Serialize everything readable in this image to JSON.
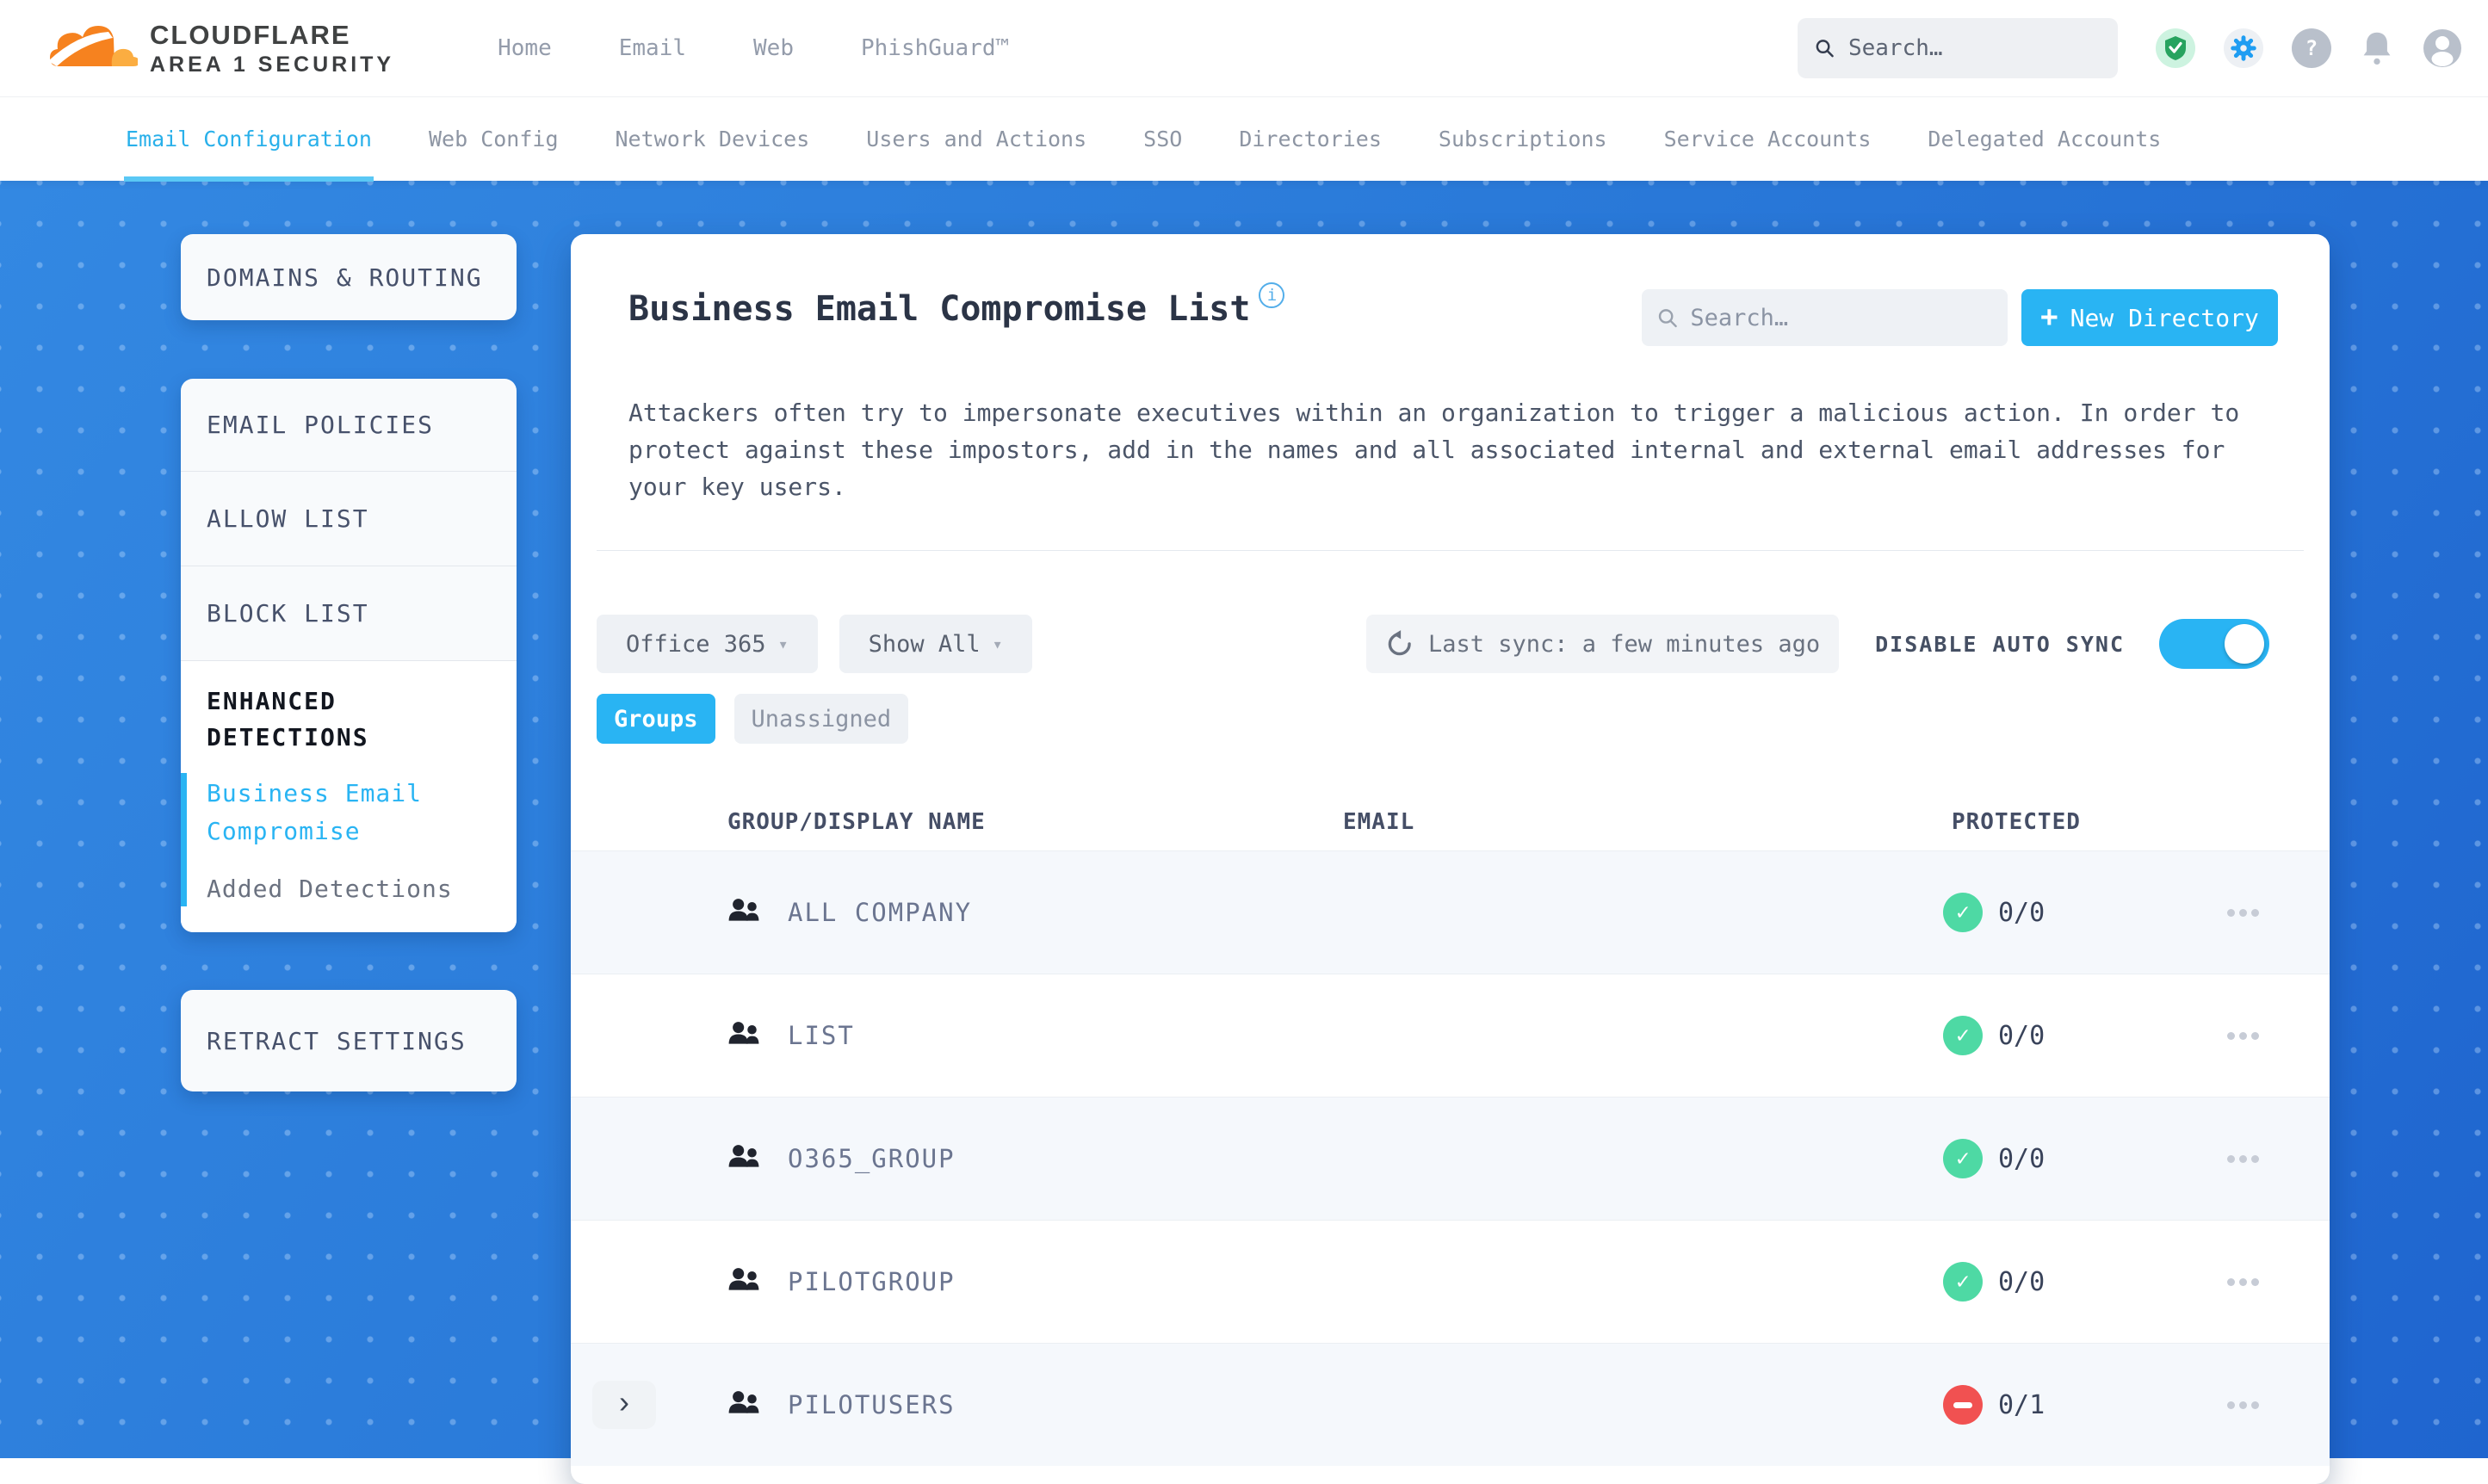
{
  "colors": {
    "accent": "#29b4f3",
    "success": "#4ed9a4",
    "danger": "#f15151",
    "canvas_blue": "#2a7ad9"
  },
  "brand": {
    "name": "CLOUDFLARE",
    "sub": "AREA 1 SECURITY"
  },
  "top_nav": {
    "items": [
      "Home",
      "Email",
      "Web",
      "PhishGuard™"
    ],
    "search_placeholder": "Search…"
  },
  "tabs": {
    "items": [
      {
        "label": "Email Configuration",
        "active": true
      },
      {
        "label": "Web Config",
        "active": false
      },
      {
        "label": "Network Devices",
        "active": false
      },
      {
        "label": "Users and Actions",
        "active": false
      },
      {
        "label": "SSO",
        "active": false
      },
      {
        "label": "Directories",
        "active": false
      },
      {
        "label": "Subscriptions",
        "active": false
      },
      {
        "label": "Service Accounts",
        "active": false
      },
      {
        "label": "Delegated Accounts",
        "active": false
      }
    ]
  },
  "sidebar": {
    "domains_routing": "DOMAINS & ROUTING",
    "email_policies": "EMAIL POLICIES",
    "allow_list": "ALLOW LIST",
    "block_list": "BLOCK LIST",
    "enhanced_detections": "ENHANCED DETECTIONS",
    "business_email_compromise": "Business Email Compromise",
    "added_detections": "Added Detections",
    "retract_settings": "RETRACT SETTINGS"
  },
  "main": {
    "title": "Business Email Compromise List",
    "search_placeholder": "Search…",
    "new_directory_label": "New Directory",
    "plus": "+",
    "description": "Attackers often try to impersonate executives within an organization to trigger a malicious action. In order to protect against these impostors, add in the names and all associated internal and external email addresses for your key users.",
    "filters": {
      "directory": "Office 365",
      "show": "Show All",
      "caret": "▾",
      "last_sync": "Last sync: a few minutes ago",
      "auto_sync_label": "DISABLE AUTO SYNC",
      "auto_sync_on": true
    },
    "segments": {
      "groups": "Groups",
      "unassigned": "Unassigned"
    }
  },
  "table": {
    "headers": {
      "name": "GROUP/DISPLAY NAME",
      "email": "EMAIL",
      "protected": "PROTECTED"
    },
    "rows": [
      {
        "name": "ALL COMPANY",
        "email": "",
        "protected": "0/0",
        "protected_ok": true,
        "expandable": false
      },
      {
        "name": "LIST",
        "email": "",
        "protected": "0/0",
        "protected_ok": true,
        "expandable": false
      },
      {
        "name": "O365_GROUP",
        "email": "",
        "protected": "0/0",
        "protected_ok": true,
        "expandable": false
      },
      {
        "name": "PILOTGROUP",
        "email": "",
        "protected": "0/0",
        "protected_ok": true,
        "expandable": false
      },
      {
        "name": "PILOTUSERS",
        "email": "",
        "protected": "0/1",
        "protected_ok": false,
        "expandable": true
      }
    ],
    "expander_glyph": "›"
  }
}
